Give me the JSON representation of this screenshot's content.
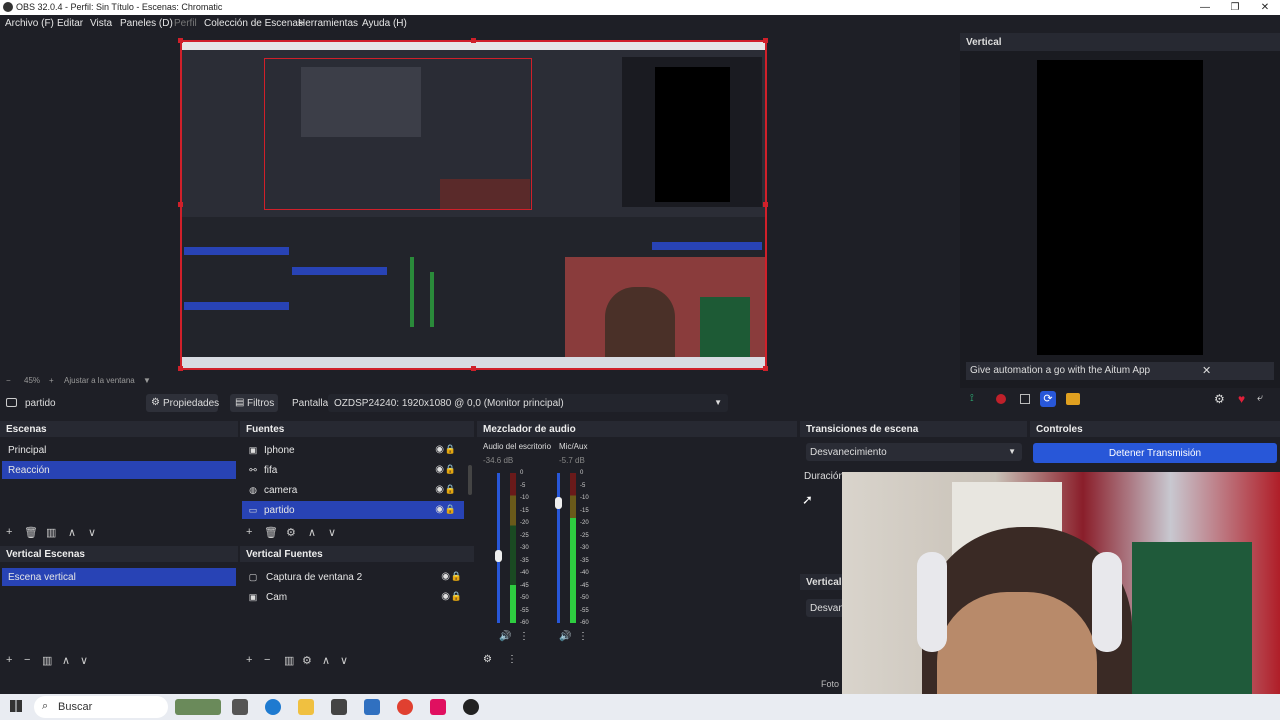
{
  "window": {
    "title": "OBS 32.0.4 - Perfil: Sin Título - Escenas: Chromatic"
  },
  "menu": {
    "items": [
      "Archivo (F)",
      "Editar",
      "Vista",
      "Paneles (D)",
      "Perfil",
      "Colección de Escenas",
      "Herramientas",
      "Ayuda (H)"
    ]
  },
  "preview": {
    "zoom": "45%",
    "fit_label": "Ajustar a la ventana"
  },
  "vertical_preview": {
    "title": "Vertical",
    "banner": "Give automation a go with the Aitum App"
  },
  "context": {
    "source_name": "partido",
    "properties": "Propiedades",
    "filters": "Filtros",
    "display_label": "Pantalla",
    "display_value": "OZDSP24240: 1920x1080 @ 0,0 (Monitor principal)"
  },
  "scenes": {
    "title": "Escenas",
    "items": [
      "Principal",
      "Reacción"
    ],
    "selected": "Reacción"
  },
  "sources": {
    "title": "Fuentes",
    "items": [
      {
        "name": "Iphone",
        "icon": "camera-icon"
      },
      {
        "name": "fifa",
        "icon": "link-icon"
      },
      {
        "name": "camera",
        "icon": "globe-icon"
      },
      {
        "name": "partido",
        "icon": "monitor-icon"
      }
    ],
    "selected": "partido"
  },
  "vertical_scenes": {
    "title": "Vertical Escenas",
    "items": [
      "Escena vertical"
    ]
  },
  "vertical_sources": {
    "title": "Vertical Fuentes",
    "items": [
      {
        "name": "Captura de ventana 2",
        "icon": "window-icon"
      },
      {
        "name": "Cam",
        "icon": "camera-icon"
      }
    ]
  },
  "mixer": {
    "title": "Mezclador de audio",
    "channels": [
      {
        "name": "Audio del escritorio",
        "db": "-34.6 dB",
        "level": 0.25,
        "fader": 0.45
      },
      {
        "name": "Mic/Aux",
        "db": "-5.7 dB",
        "level": 0.7,
        "fader": 0.8
      }
    ],
    "scale": [
      "0",
      "-5",
      "-10",
      "-15",
      "-20",
      "-25",
      "-30",
      "-35",
      "-40",
      "-45",
      "-50",
      "-55",
      "-60"
    ]
  },
  "transitions": {
    "title": "Transiciones de escena",
    "selected": "Desvanecimiento",
    "duration_label": "Duración",
    "vertical_label": "Vertical",
    "vertical_value": "Desvane"
  },
  "controls": {
    "title": "Controles",
    "stop_stream": "Detener Transmisión"
  },
  "status": {
    "text": "Foto"
  },
  "taskbar": {
    "search": "Buscar"
  },
  "colors": {
    "accent": "#2843b5",
    "recording_border": "#d0202a",
    "background": "#1e1f26"
  }
}
